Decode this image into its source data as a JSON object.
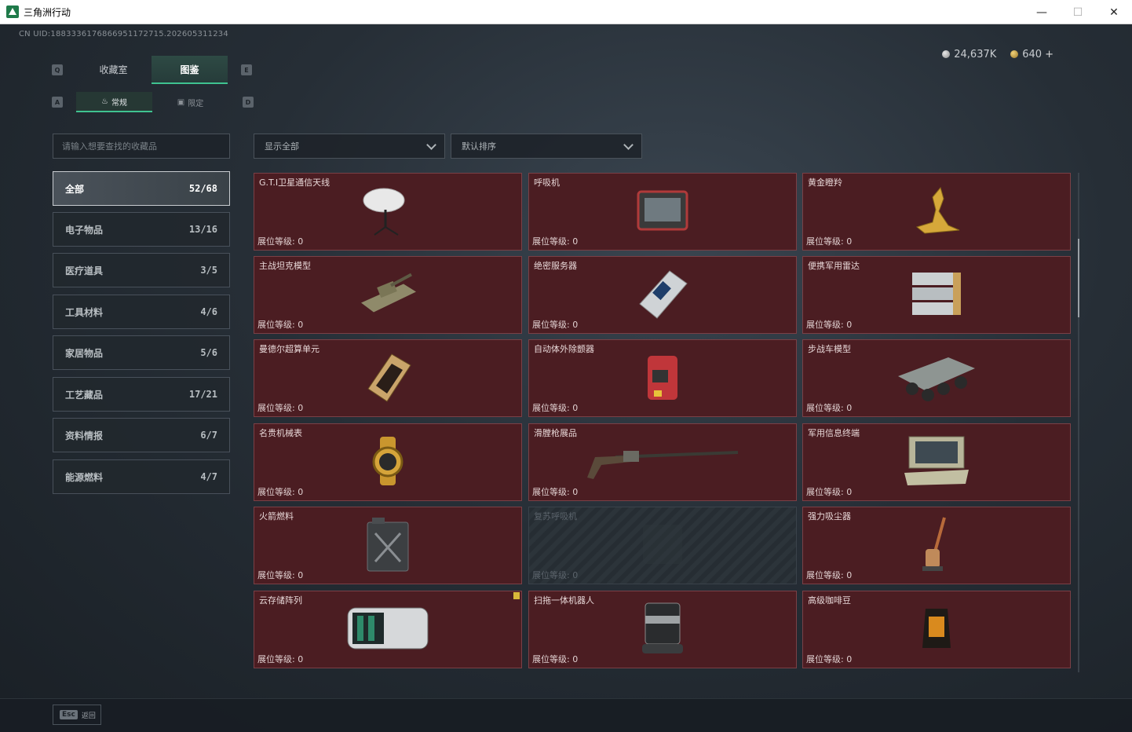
{
  "window": {
    "title": "三角洲行动",
    "min": "—",
    "max": "☐",
    "close": "✕"
  },
  "uid": "CN UID:1883336176866951172715.202605311234",
  "currency": {
    "silver": "24,637K",
    "gold": "640",
    "plus": "+"
  },
  "keys": {
    "tab_left": "Q",
    "tab_right": "E",
    "sub_left": "A",
    "sub_right": "D"
  },
  "tabs": [
    {
      "label": "收藏室"
    },
    {
      "label": "图鉴"
    }
  ],
  "subtabs": [
    {
      "label": "常规"
    },
    {
      "label": "限定"
    }
  ],
  "search": {
    "placeholder": "请输入想要查找的收藏品"
  },
  "filters": {
    "show": "显示全部",
    "sort": "默认排序"
  },
  "categories": [
    {
      "label": "全部",
      "count": "52/68"
    },
    {
      "label": "电子物品",
      "count": "13/16"
    },
    {
      "label": "医疗道具",
      "count": "3/5"
    },
    {
      "label": "工具材料",
      "count": "4/6"
    },
    {
      "label": "家居物品",
      "count": "5/6"
    },
    {
      "label": "工艺藏品",
      "count": "17/21"
    },
    {
      "label": "资料情报",
      "count": "6/7"
    },
    {
      "label": "能源燃料",
      "count": "4/7"
    }
  ],
  "items": [
    {
      "name": "G.T.I卫星通信天线",
      "level": "展位等级: 0",
      "icon": "satellite-dish-icon"
    },
    {
      "name": "呼吸机",
      "level": "展位等级: 0",
      "icon": "ventilator-icon"
    },
    {
      "name": "黄金瞪羚",
      "level": "展位等级: 0",
      "icon": "golden-gazelle-icon"
    },
    {
      "name": "主战坦克模型",
      "level": "展位等级: 0",
      "icon": "tank-model-icon"
    },
    {
      "name": "绝密服务器",
      "level": "展位等级: 0",
      "icon": "server-icon"
    },
    {
      "name": "便携军用雷达",
      "level": "展位等级: 0",
      "icon": "radar-icon"
    },
    {
      "name": "曼德尔超算单元",
      "level": "展位等级: 0",
      "icon": "compute-unit-icon"
    },
    {
      "name": "自动体外除颤器",
      "level": "展位等级: 0",
      "icon": "defibrillator-icon"
    },
    {
      "name": "步战车模型",
      "level": "展位等级: 0",
      "icon": "ifv-model-icon"
    },
    {
      "name": "名贵机械表",
      "level": "展位等级: 0",
      "icon": "watch-icon"
    },
    {
      "name": "滑膛枪展品",
      "level": "展位等级: 0",
      "icon": "musket-icon"
    },
    {
      "name": "军用信息终端",
      "level": "展位等级: 0",
      "icon": "terminal-icon"
    },
    {
      "name": "火箭燃料",
      "level": "展位等级: 0",
      "icon": "fuel-can-icon"
    },
    {
      "name": "复苏呼吸机",
      "level": "展位等级: 0",
      "icon": "resuscitator-icon",
      "locked": true
    },
    {
      "name": "强力吸尘器",
      "level": "展位等级: 0",
      "icon": "vacuum-icon"
    },
    {
      "name": "云存储阵列",
      "level": "展位等级: 0",
      "icon": "storage-array-icon"
    },
    {
      "name": "扫拖一体机器人",
      "level": "展位等级: 0",
      "icon": "robot-vacuum-icon"
    },
    {
      "name": "高级咖啡豆",
      "level": "展位等级: 0",
      "icon": "coffee-bag-icon"
    }
  ],
  "footer": {
    "key": "Esc",
    "label": "返回"
  }
}
